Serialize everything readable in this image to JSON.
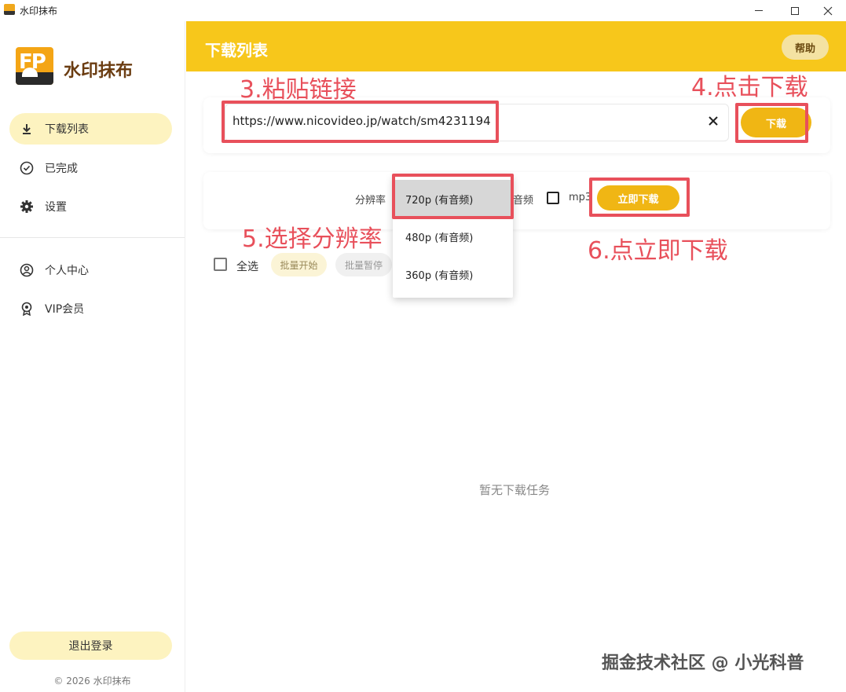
{
  "window": {
    "title": "水印抹布",
    "controls": [
      "minimize",
      "maximize",
      "close"
    ]
  },
  "sidebar": {
    "brand_name": "水印抹布",
    "brand_logo_letters": "FP",
    "items": [
      {
        "label": "下载列表",
        "icon": "download-icon",
        "active": true
      },
      {
        "label": "已完成",
        "icon": "check-circle-icon",
        "active": false
      },
      {
        "label": "设置",
        "icon": "gear-icon",
        "active": false
      }
    ],
    "account_items": [
      {
        "label": "个人中心",
        "icon": "user-circle-icon"
      },
      {
        "label": "VIP会员",
        "icon": "badge-icon"
      }
    ],
    "logout_label": "退出登录",
    "copyright": "© 2026 水印抹布"
  },
  "header": {
    "title": "下载列表",
    "help_label": "帮助",
    "accent_color": "#f7c71b"
  },
  "url_bar": {
    "value": "https://www.nicovideo.jp/watch/sm4231194",
    "download_label": "下载"
  },
  "options": {
    "resolution_label": "分辨率",
    "audio_label": "音频",
    "mp3_label": "mp3",
    "mp3_checked": false,
    "download_now_label": "立即下载",
    "resolutions": [
      "720p (有音频)",
      "480p (有音频)",
      "360p (有音频)"
    ],
    "selected_resolution": "720p (有音频)"
  },
  "list": {
    "select_all_label": "全选",
    "batch_start_label": "批量开始",
    "batch_pause_label": "批量暂停",
    "empty_text": "暂无下载任务"
  },
  "annotations": [
    {
      "text": "3.粘贴链接"
    },
    {
      "text": "4.点击下载"
    },
    {
      "text": "5.选择分辨率"
    },
    {
      "text": "6.点立即下载"
    }
  ],
  "watermark": "掘金技术社区 @ 小光科普",
  "colors": {
    "annotation": "#e8505b",
    "button": "#f0b614",
    "nav_active": "#fdf3c0"
  }
}
